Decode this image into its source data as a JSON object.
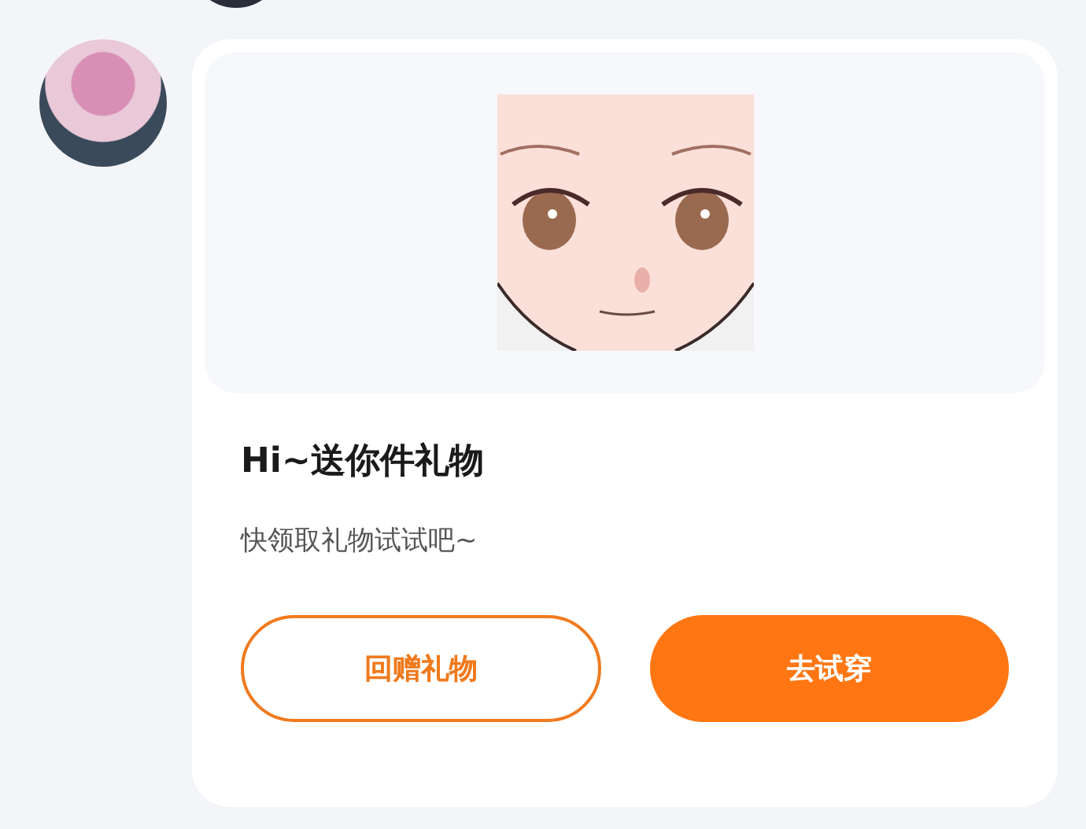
{
  "card": {
    "title": "Hi~送你件礼物",
    "subtitle": "快领取礼物试试吧~",
    "buttons": [
      {
        "label": "回赠礼物",
        "kind": "outline"
      },
      {
        "label": "去试穿",
        "kind": "filled"
      }
    ]
  }
}
